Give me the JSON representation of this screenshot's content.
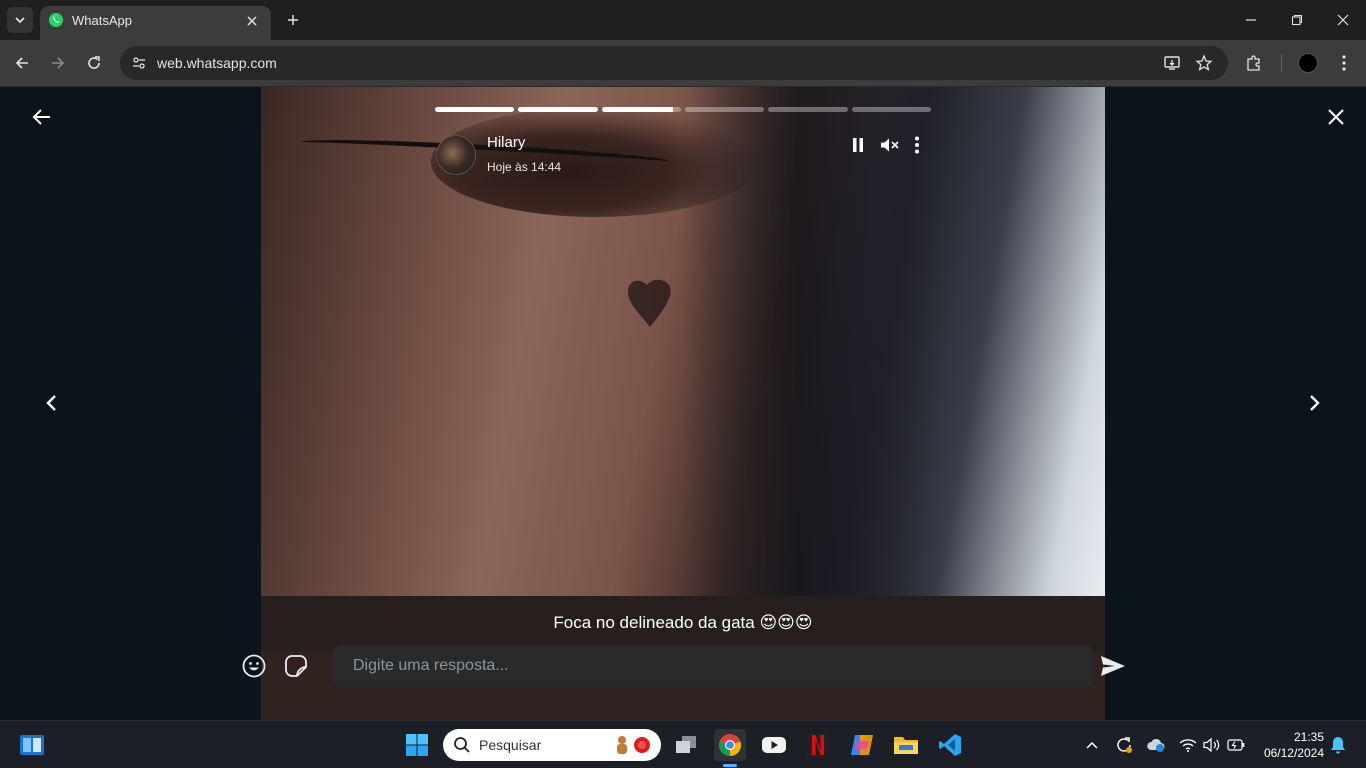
{
  "browser": {
    "tab_title": "WhatsApp",
    "url": "web.whatsapp.com"
  },
  "status": {
    "sender_name": "Hilary",
    "timestamp": "Hoje às 14:44",
    "caption": "Foca no delineado da gata 😍😍😍",
    "progress_segments": [
      1,
      1,
      0.9,
      0,
      0,
      0
    ],
    "reply_placeholder": "Digite uma resposta..."
  },
  "taskbar": {
    "search_placeholder": "Pesquisar",
    "clock_time": "21:35",
    "clock_date": "06/12/2024"
  },
  "icons": {
    "tab_favicon": "whatsapp-icon",
    "back": "arrow-left-icon",
    "close": "close-icon",
    "prev": "chevron-left-icon",
    "next": "chevron-right-icon",
    "pause": "pause-icon",
    "mute": "volume-mute-icon",
    "menu": "kebab-menu-icon",
    "emoji": "emoji-icon",
    "sticker": "sticker-icon",
    "send": "send-icon"
  },
  "colors": {
    "viewer_bg": "#0b141a",
    "whatsapp_green": "#25d366",
    "chrome_dark": "#1f1f1f",
    "taskbar_bg": "#1c1f26"
  }
}
